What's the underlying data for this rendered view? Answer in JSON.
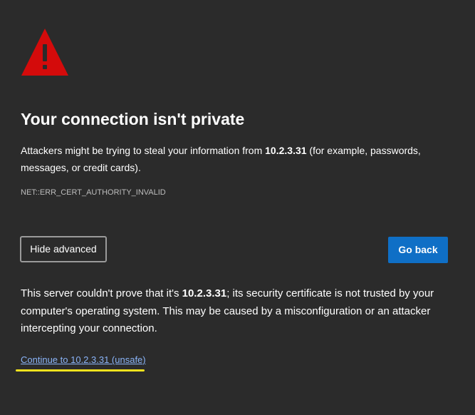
{
  "colors": {
    "background": "#2b2b2b",
    "warning_red": "#d40b0b",
    "primary_button": "#0f6fc6",
    "link": "#8ab4f8",
    "highlight": "#f4e21d"
  },
  "icons": {
    "warning": "warning-triangle-icon"
  },
  "page": {
    "title": "Your connection isn't private",
    "desc_prefix": "Attackers might be trying to steal your information from ",
    "host": "10.2.3.31",
    "desc_suffix": " (for example, passwords, messages, or credit cards).",
    "error_code": "NET::ERR_CERT_AUTHORITY_INVALID"
  },
  "buttons": {
    "hide_advanced": "Hide advanced",
    "go_back": "Go back"
  },
  "advanced": {
    "prefix": "This server couldn't prove that it's ",
    "host": "10.2.3.31",
    "suffix": "; its security certificate is not trusted by your computer's operating system. This may be caused by a misconfiguration or an attacker intercepting your connection.",
    "continue_link": "Continue to 10.2.3.31 (unsafe)"
  }
}
